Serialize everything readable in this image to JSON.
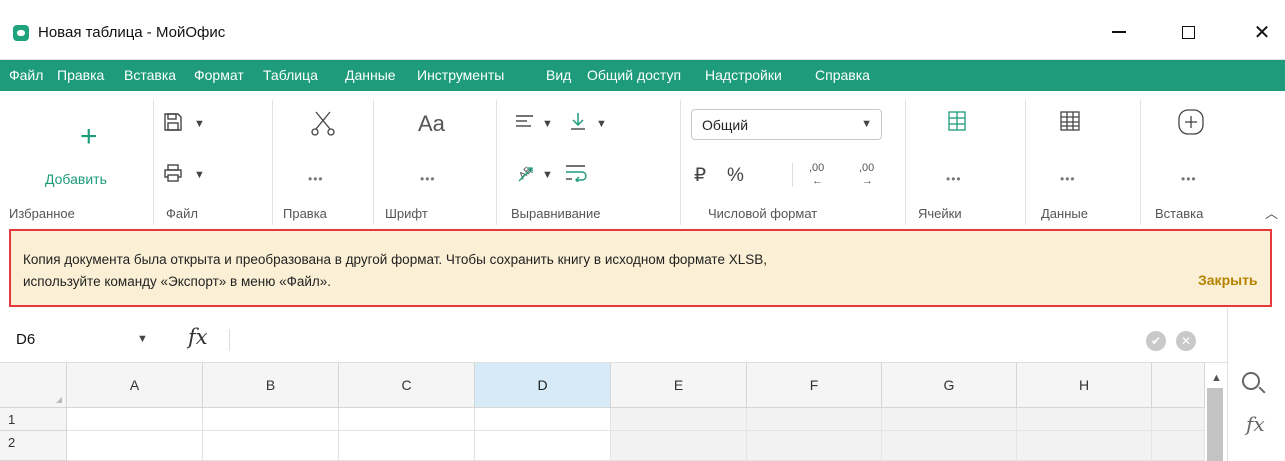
{
  "window": {
    "title": "Новая таблица - МойОфис",
    "minimize": "",
    "maximize": "",
    "close": "✕"
  },
  "menu": [
    "Файл",
    "Правка",
    "Вставка",
    "Формат",
    "Таблица",
    "Данные",
    "Инструменты",
    "Вид",
    "Общий доступ",
    "Надстройки",
    "Справка"
  ],
  "ribbon": {
    "favorites": {
      "add_label": "Добавить",
      "group": "Избранное"
    },
    "file": {
      "group": "Файл"
    },
    "edit": {
      "group": "Правка",
      "more": "•••"
    },
    "font": {
      "group": "Шрифт",
      "font_icon": "Aa",
      "more": "•••"
    },
    "align": {
      "group": "Выравнивание"
    },
    "number_format": {
      "group": "Числовой формат",
      "selected": "Общий",
      "currency": "₽",
      "percent": "%",
      "dec_less": ",00",
      "dec_more": ",00"
    },
    "cells": {
      "group": "Ячейки",
      "more": "•••"
    },
    "data": {
      "group": "Данные",
      "more": "•••"
    },
    "insert": {
      "group": "Вставка",
      "more": "•••"
    }
  },
  "notice": {
    "text_line1": "Копия документа была открыта и преобразована в другой формат. Чтобы сохранить книгу в исходном формате XLSB,",
    "text_line2": "используйте команду «Экспорт» в меню «Файл».",
    "close_label": "Закрыть"
  },
  "formula_bar": {
    "cell_ref": "D6",
    "fx_label": "fx",
    "value": ""
  },
  "grid": {
    "columns": [
      "A",
      "B",
      "C",
      "D",
      "E",
      "F",
      "G",
      "H"
    ],
    "selected_column": "D",
    "rows": [
      "1",
      "2"
    ]
  },
  "colors": {
    "accent": "#1d9b7a",
    "notice_bg": "#fbf0d5",
    "notice_border": "#e33b3b",
    "selected_header": "#d6eaf7"
  },
  "icons": [
    "app-logo-icon",
    "save-icon",
    "print-icon",
    "cut-icon",
    "align-left-icon",
    "align-bottom-icon",
    "text-rotate-icon",
    "wrap-text-icon",
    "cells-icon",
    "table-icon",
    "insert-plus-icon",
    "search-icon",
    "fx-icon"
  ]
}
